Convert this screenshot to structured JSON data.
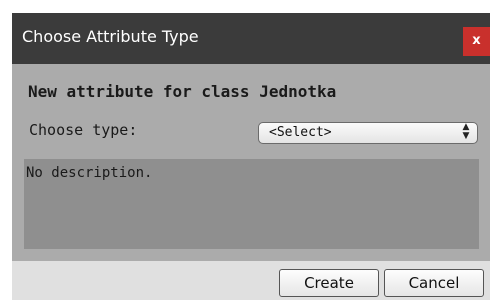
{
  "window": {
    "title": "Choose Attribute Type",
    "close_label": "x"
  },
  "form": {
    "heading": "New attribute for class Jednotka",
    "type_label": "Choose type:",
    "type_select": {
      "selected": "<Select>",
      "arrow_icons": [
        "chevron-up-icon",
        "chevron-down-icon"
      ]
    },
    "description": "No description."
  },
  "footer": {
    "create_label": "Create",
    "cancel_label": "Cancel"
  },
  "colors": {
    "titlebar": "#3b3b3b",
    "close_button": "#c9302c",
    "dialog_body": "#ababab",
    "description_box": "#8f8f8f",
    "footer": "#e0e0e0"
  }
}
